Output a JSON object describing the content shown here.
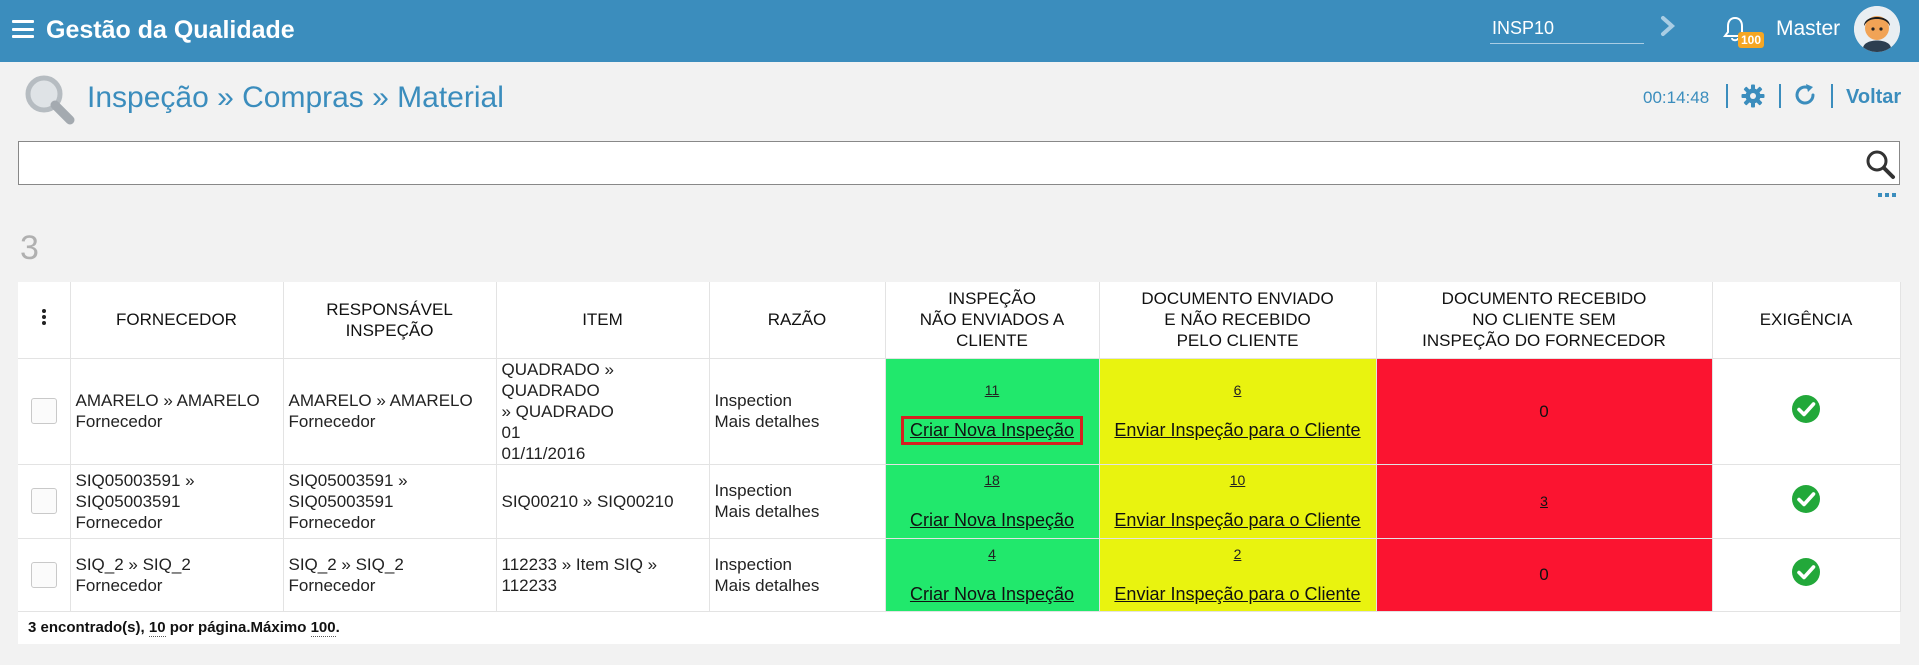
{
  "app": {
    "title": "Gestão da Qualidade"
  },
  "header": {
    "code_value": "INSP10",
    "notification_count": "100",
    "user_name": "Master"
  },
  "page": {
    "breadcrumb": "Inspeção » Compras » Material",
    "timer": "00:14:48",
    "back_label": "Voltar",
    "result_count": "3"
  },
  "search": {
    "value": ""
  },
  "colors": {
    "topbar": "#3b8dbd",
    "green": "#21e86c",
    "yellow": "#e9f30f",
    "red": "#fb1430",
    "ok": "#22a83a"
  },
  "table": {
    "columns": {
      "fornecedor": "FORNECEDOR",
      "responsavel": [
        "RESPONSÁVEL",
        "INSPEÇÃO"
      ],
      "item": "ITEM",
      "razao": "RAZÃO",
      "inspecao": [
        "INSPEÇÃO",
        "NÃO ENVIADOS A",
        "CLIENTE"
      ],
      "doc_enviado": [
        "DOCUMENTO ENVIADO",
        "E NÃO RECEBIDO",
        "PELO CLIENTE"
      ],
      "doc_recebido": [
        "DOCUMENTO RECEBIDO",
        "NO CLIENTE SEM",
        "INSPEÇÃO DO FORNECEDOR"
      ],
      "exigencia": "EXIGÊNCIA"
    },
    "rows": [
      {
        "fornecedor": [
          "AMARELO » AMARELO",
          "Fornecedor"
        ],
        "responsavel": [
          "AMARELO » AMARELO",
          "Fornecedor"
        ],
        "item": [
          "QUADRADO » QUADRADO",
          "» QUADRADO",
          "01",
          "01/11/2016"
        ],
        "razao": [
          "Inspection",
          "Mais detalhes"
        ],
        "inspecao_count": "11",
        "inspecao_action": "Criar Nova Inspeção",
        "doc_enviado_count": "6",
        "doc_enviado_action": "Enviar Inspeção para o Cliente",
        "doc_recebido": "0"
      },
      {
        "fornecedor": [
          "SIQ05003591 »",
          "SIQ05003591",
          "Fornecedor"
        ],
        "responsavel": [
          "SIQ05003591 »",
          "SIQ05003591",
          "Fornecedor"
        ],
        "item": [
          "SIQ00210 » SIQ00210"
        ],
        "razao": [
          "Inspection",
          "Mais detalhes"
        ],
        "inspecao_count": "18",
        "inspecao_action": "Criar Nova Inspeção",
        "doc_enviado_count": "10",
        "doc_enviado_action": "Enviar Inspeção para o Cliente",
        "doc_recebido": "3"
      },
      {
        "fornecedor": [
          "SIQ_2 » SIQ_2",
          "Fornecedor"
        ],
        "responsavel": [
          "SIQ_2 » SIQ_2",
          "Fornecedor"
        ],
        "item": [
          "112233 » Item SIQ »",
          "112233"
        ],
        "razao": [
          "Inspection",
          "Mais detalhes"
        ],
        "inspecao_count": "4",
        "inspecao_action": "Criar Nova Inspeção",
        "doc_enviado_count": "2",
        "doc_enviado_action": "Enviar Inspeção para o Cliente",
        "doc_recebido": "0"
      }
    ]
  },
  "footer": {
    "found_count": "3",
    "found_text": " encontrado(s), ",
    "per_page": "10",
    "per_page_text": " por página.Máximo ",
    "max": "100",
    "end": "."
  }
}
